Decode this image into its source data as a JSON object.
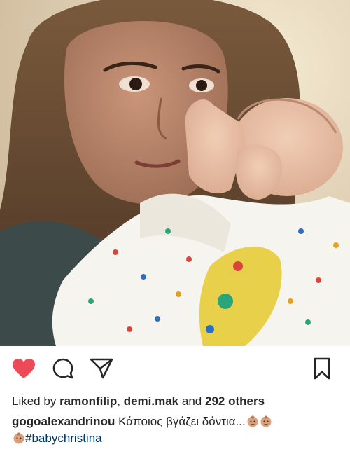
{
  "photo": {
    "alt_name": "mother-and-baby-photo"
  },
  "actions": {
    "like_icon": "heart-filled-icon",
    "comment_icon": "comment-bubble-icon",
    "share_icon": "paper-plane-icon",
    "save_icon": "bookmark-icon",
    "like_color": "#ed4956"
  },
  "likes": {
    "prefix": "Liked by",
    "user1": "ramonfilip",
    "separator": ",",
    "user2": "demi.mak",
    "conjunction": "and",
    "others": "292 others"
  },
  "caption": {
    "username": "gogoalexandrinou",
    "text": "Κάποιος βγάζει δόντια...",
    "emoji": "baby-emoji",
    "hashtag": "#babychristina"
  }
}
